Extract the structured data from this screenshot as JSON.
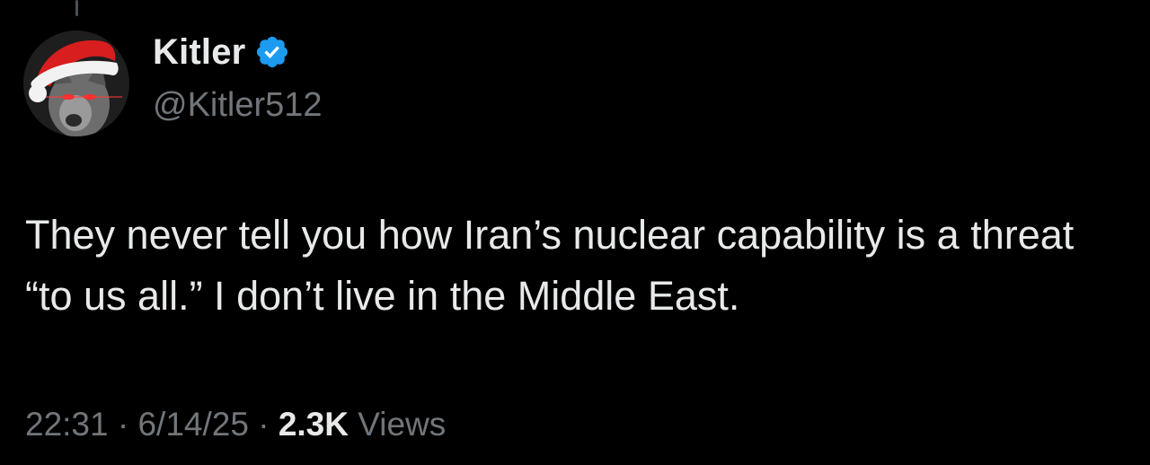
{
  "author": {
    "display_name": "Kitler",
    "handle": "@Kitler512",
    "verified": true,
    "avatar_icon": "cat-santa-hat-avatar-icon",
    "verified_icon": "verified-badge-icon",
    "verified_color": "#1d9bf0"
  },
  "tweet": {
    "text": "They never tell you how Iran’s nuclear capability is a threat “to us all.” I don’t live in the Middle East."
  },
  "meta": {
    "time": "22:31",
    "separator": "·",
    "date": "6/14/25",
    "views_count": "2.3K",
    "views_label": "Views"
  },
  "colors": {
    "background": "#000000",
    "primary_text": "#e7e9ea",
    "secondary_text": "#71767b"
  }
}
